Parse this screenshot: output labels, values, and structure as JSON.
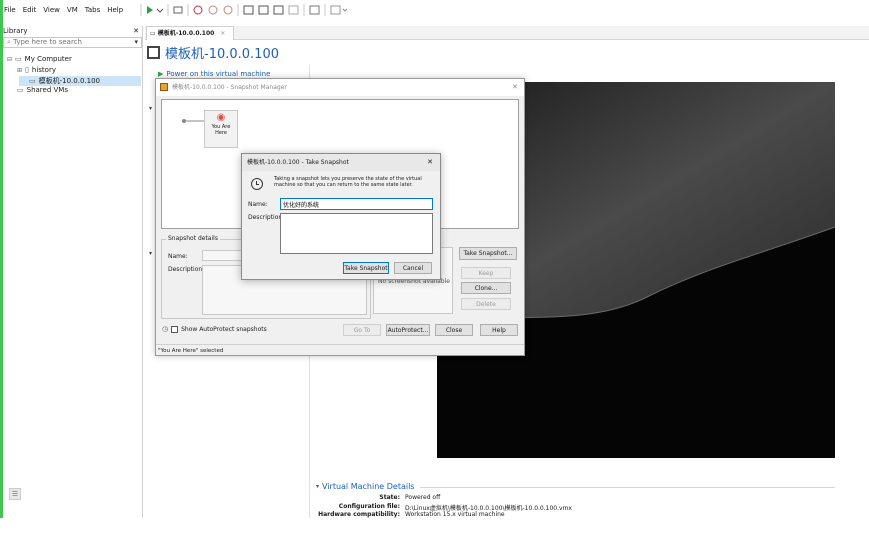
{
  "menu": [
    "File",
    "Edit",
    "View",
    "VM",
    "Tabs",
    "Help"
  ],
  "library": {
    "title": "Library",
    "search_placeholder": "Type here to search",
    "tree": [
      {
        "label": "My Computer",
        "level": 0
      },
      {
        "label": "history",
        "level": 1
      },
      {
        "label": "模板机-10.0.0.100",
        "level": 2
      },
      {
        "label": "Shared VMs",
        "level": 0
      }
    ]
  },
  "tab": {
    "label": "模板机-10.0.0.100"
  },
  "vm_title": "模板机-10.0.0.100",
  "power_on": "Power on this virtual machine",
  "snapshot_manager": {
    "title": "模板机-10.0.0.100 - Snapshot Manager",
    "you_are_here": "You Are Here",
    "details_label": "Snapshot details",
    "name_label": "Name:",
    "description_label": "Description:",
    "no_screenshot": "No screenshot available",
    "show_autoprotect": "Show AutoProtect snapshots",
    "buttons": {
      "take_snapshot": "Take Snapshot...",
      "keep": "Keep",
      "clone": "Clone...",
      "delete": "Delete",
      "go_to": "Go To",
      "autoprotect": "AutoProtect...",
      "close": "Close",
      "help": "Help"
    },
    "status": "\"You Are Here\" selected"
  },
  "take_snapshot": {
    "title": "模板机-10.0.0.100 - Take Snapshot",
    "info": "Taking a snapshot lets you preserve the state of the virtual machine so that you can return to the same state later.",
    "name_label": "Name:",
    "name_value": "优化好的系统",
    "description_label": "Description:",
    "ok": "Take Snapshot",
    "cancel": "Cancel"
  },
  "vm_details": {
    "header": "Virtual Machine Details",
    "state_label": "State:",
    "state_value": "Powered off",
    "config_label": "Configuration file:",
    "config_value": "D:\\Linux虚拟机\\模板机-10.0.0.100\\模板机-10.0.0.100.vmx",
    "hw_label": "Hardware compatibility:",
    "hw_value": "Workstation 15.x virtual machine"
  },
  "colors": {
    "accent_green": "#3cc84a",
    "selection": "#cce4f7",
    "link_blue": "#1c5fb8",
    "play_green": "#2ea043"
  }
}
